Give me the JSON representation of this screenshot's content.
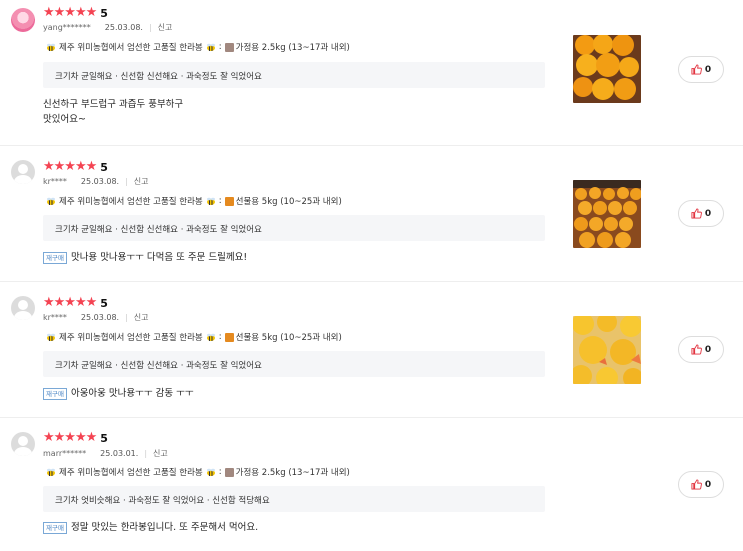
{
  "reviews": [
    {
      "avatar": "character-avatar",
      "rating": 5,
      "stars": "★★★★★",
      "user": "yang*******",
      "date": "25.03.08.",
      "report": "신고",
      "option_prefix": "제주 위미농협에서 엄선한 고품질 한라봉",
      "option_value": "가정용 2.5kg (13~17과 내외)",
      "option_box_color": "#a1887f",
      "evaluation": "크기차 균일해요 · 신선함 신선해요 · 과숙정도 잘 익었어요",
      "repurchase": "",
      "lines": [
        "신선하구 부드럽구 과즙두 풍부하구",
        "맛있어요~"
      ],
      "likes": "0"
    },
    {
      "avatar": "default-avatar",
      "rating": 5,
      "stars": "★★★★★",
      "user": "kr****",
      "date": "25.03.08.",
      "report": "신고",
      "option_prefix": "제주 위미농협에서 엄선한 고품질 한라봉",
      "option_value": "선물용 5kg (10~25과 내외)",
      "option_box_color": "#e58a1f",
      "evaluation": "크기차 균일해요 · 신선함 신선해요 · 과숙정도 잘 익었어요",
      "repurchase": "재구매",
      "lines": [
        "맛나용 맛나용ㅜㅜ 다먹음 또 주문 드릴께요!"
      ],
      "likes": "0"
    },
    {
      "avatar": "default-avatar",
      "rating": 5,
      "stars": "★★★★★",
      "user": "kr****",
      "date": "25.03.08.",
      "report": "신고",
      "option_prefix": "제주 위미농협에서 엄선한 고품질 한라봉",
      "option_value": "선물용 5kg (10~25과 내외)",
      "option_box_color": "#e58a1f",
      "evaluation": "크기차 균일해요 · 신선함 신선해요 · 과숙정도 잘 익었어요",
      "repurchase": "재구매",
      "lines": [
        "아웅아웅 맛나용ㅜㅜ 감동 ㅜㅜ"
      ],
      "likes": "0"
    },
    {
      "avatar": "default-avatar",
      "rating": 5,
      "stars": "★★★★★",
      "user": "marr******",
      "date": "25.03.01.",
      "report": "신고",
      "option_prefix": "제주 위미농협에서 엄선한 고품질 한라봉",
      "option_value": "가정용 2.5kg (13~17과 내외)",
      "option_box_color": "#a1887f",
      "evaluation": "크기차 엇비슷해요 · 과숙정도 잘 익었어요 · 신선함 적당해요",
      "repurchase": "재구매",
      "lines": [
        "정말 맛있는 한라봉입니다. 또 주문해서 먹어요."
      ],
      "likes": "0"
    }
  ],
  "colors": {
    "star": "#f44352",
    "badge": "#4a84c4",
    "eval_bg": "#f5f6f8"
  }
}
